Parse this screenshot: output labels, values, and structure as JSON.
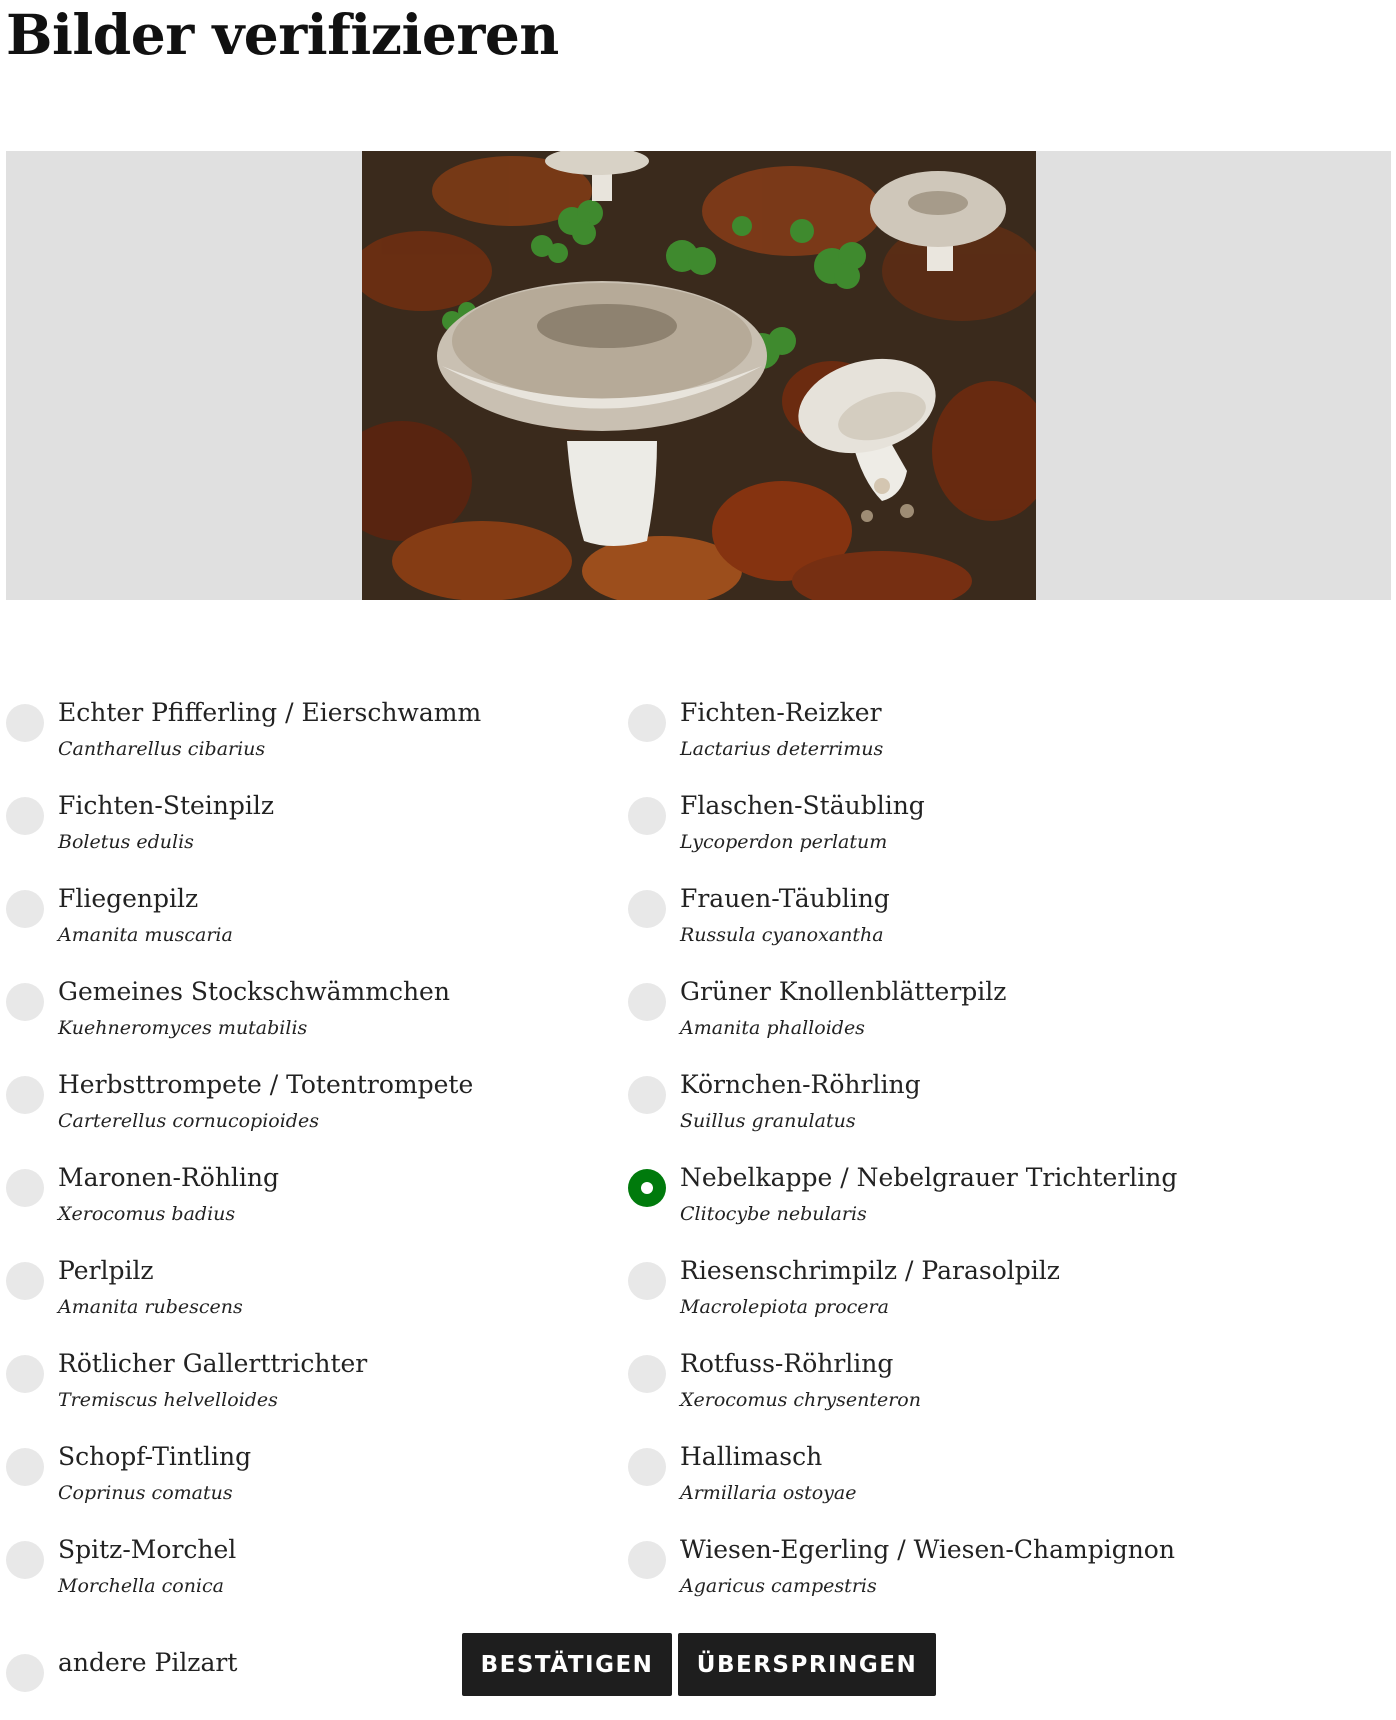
{
  "page": {
    "title": "Bilder verifizieren"
  },
  "options": [
    {
      "name": "Echter Pfifferling / Eierschwamm",
      "latin": "Cantharellus cibarius",
      "checked": false
    },
    {
      "name": "Fichten-Reizker",
      "latin": "Lactarius deterrimus",
      "checked": false
    },
    {
      "name": "Fichten-Steinpilz",
      "latin": "Boletus edulis",
      "checked": false
    },
    {
      "name": "Flaschen-Stäubling",
      "latin": "Lycoperdon perlatum",
      "checked": false
    },
    {
      "name": "Fliegenpilz",
      "latin": "Amanita muscaria",
      "checked": false
    },
    {
      "name": "Frauen-Täubling",
      "latin": "Russula cyanoxantha",
      "checked": false
    },
    {
      "name": "Gemeines Stockschwämmchen",
      "latin": "Kuehneromyces mutabilis",
      "checked": false
    },
    {
      "name": "Grüner Knollenblätterpilz",
      "latin": "Amanita phalloides",
      "checked": false
    },
    {
      "name": "Herbsttrompete / Totentrompete",
      "latin": "Carterellus cornucopioides",
      "checked": false
    },
    {
      "name": "Körnchen-Röhrling",
      "latin": "Suillus granulatus",
      "checked": false
    },
    {
      "name": "Maronen-Röhling",
      "latin": "Xerocomus badius",
      "checked": false
    },
    {
      "name": "Nebelkappe / Nebelgrauer Trichterling",
      "latin": "Clitocybe nebularis",
      "checked": true
    },
    {
      "name": "Perlpilz",
      "latin": "Amanita rubescens",
      "checked": false
    },
    {
      "name": "Riesenschrimpilz / Parasolpilz",
      "latin": "Macrolepiota procera",
      "checked": false
    },
    {
      "name": "Rötlicher Gallerttrichter",
      "latin": "Tremiscus helvelloides",
      "checked": false
    },
    {
      "name": "Rotfuss-Röhrling",
      "latin": "Xerocomus chrysenteron",
      "checked": false
    },
    {
      "name": "Schopf-Tintling",
      "latin": "Coprinus comatus",
      "checked": false
    },
    {
      "name": "Hallimasch",
      "latin": "Armillaria ostoyae",
      "checked": false
    },
    {
      "name": "Spitz-Morchel",
      "latin": "Morchella conica",
      "checked": false
    },
    {
      "name": "Wiesen-Egerling / Wiesen-Champignon",
      "latin": "Agaricus campestris",
      "checked": false
    },
    {
      "name": "andere Pilzart",
      "latin": "",
      "checked": false
    }
  ],
  "actions": {
    "confirm_label": "BESTÄTIGEN",
    "skip_label": "ÜBERSPRINGEN"
  },
  "colors": {
    "selected": "#007a0c",
    "unselected": "#e8e8e8",
    "button_bg": "#1e1e1e",
    "image_frame": "#e0e0e0"
  }
}
